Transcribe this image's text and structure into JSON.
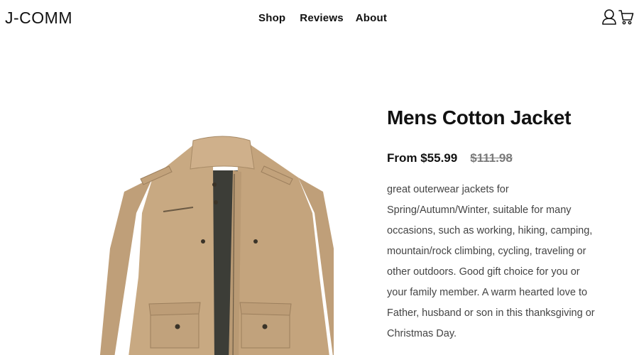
{
  "header": {
    "logo": "J-COMM",
    "nav": {
      "shop": "Shop",
      "reviews": "Reviews",
      "about": "About"
    },
    "icons": [
      "user-icon",
      "cart-icon"
    ]
  },
  "product": {
    "title": "Mens Cotton Jacket",
    "price": "From $55.99",
    "old_price": "$111.98",
    "description": "great outerwear jackets for Spring/Autumn/Winter, suitable for many occasions, such as working, hiking, camping, mountain/rock climbing, cycling, traveling or other outdoors. Good gift choice for you or your family member. A warm hearted love to Father, husband or son in this thanksgiving or Christmas Day.",
    "image_icon": "khaki-jacket-image"
  },
  "colors": {
    "text": "#111111",
    "muted": "#7a7a7a",
    "body_text": "#444444",
    "jacket": "#c8a982"
  }
}
